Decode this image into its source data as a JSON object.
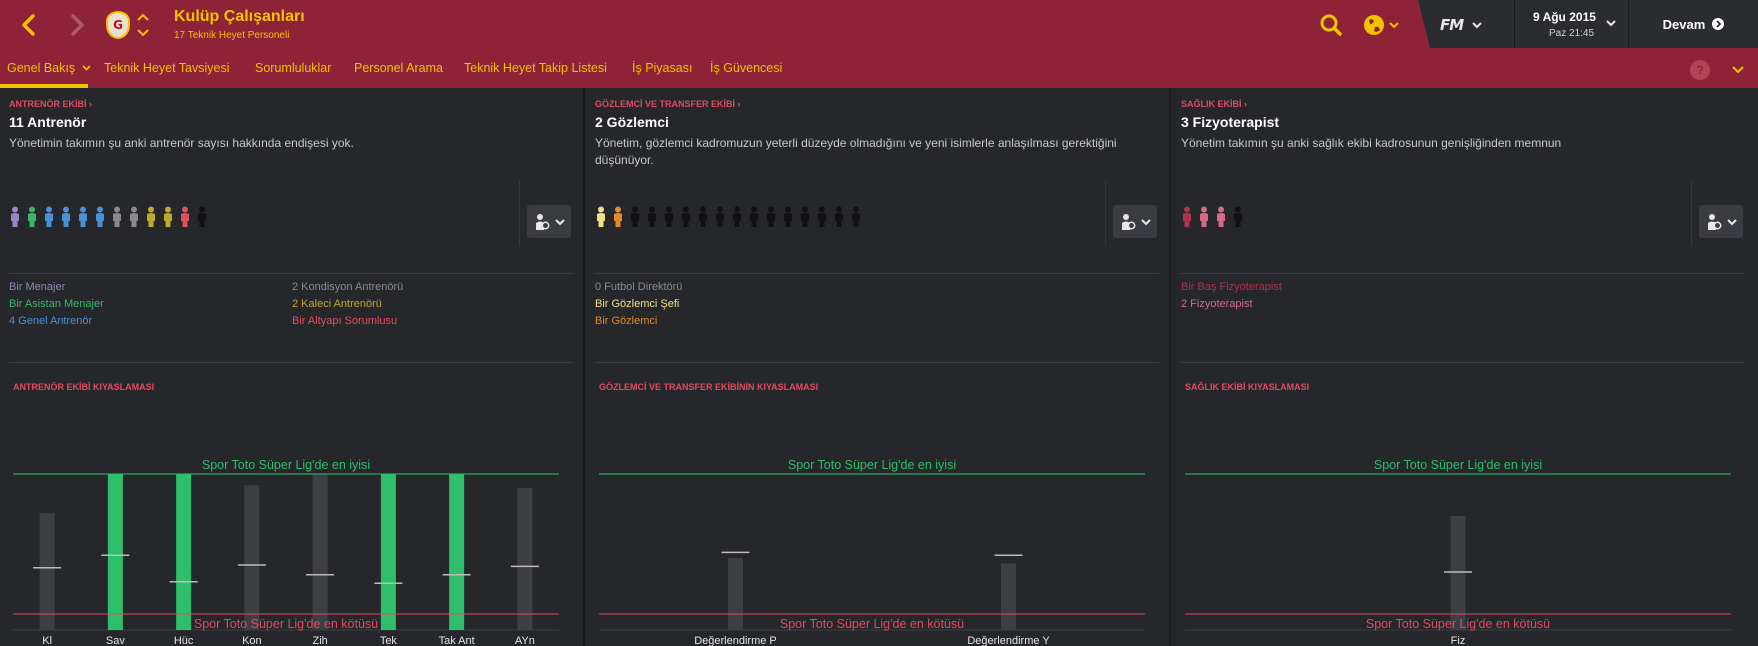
{
  "header": {
    "back_icon": "chevron-left-icon",
    "forward_icon": "chevron-right-icon",
    "club_badge_letter": "G",
    "title": "Kulüp Çalışanları",
    "subtitle": "17 Teknik Heyet Personeli",
    "game_logo": "FM",
    "date": "9 Ağu 2015",
    "time": "Paz 21:45",
    "continue_label": "Devam",
    "accent_color": "#f2c200",
    "bar_color": "#8e2337"
  },
  "tabs": [
    {
      "label": "Genel Bakış",
      "active": true
    },
    {
      "label": "Teknik Heyet Tavsiyesi"
    },
    {
      "label": "Sorumluluklar"
    },
    {
      "label": "Personel Arama"
    },
    {
      "label": "Teknik Heyet Takip Listesi"
    },
    {
      "label": "İş Piyasası"
    },
    {
      "label": "İş Güvencesi"
    }
  ],
  "help_label": "?",
  "panels": [
    {
      "section_label": "ANTRENÖR EKİBİ",
      "count_title": "11 Antrenör",
      "board_text": "Yönetimin takımın şu anki antrenör sayısı hakkında endişesi yok.",
      "people_colors": [
        "#9b86c4",
        "#3ab56c",
        "#4a90d6",
        "#4a90d6",
        "#4a90d6",
        "#4a90d6",
        "#8a8a8a",
        "#8a8a8a",
        "#c2a82c",
        "#c2a82c",
        "#e0505e",
        "#111111"
      ],
      "roles": [
        {
          "text": "Bir Menajer",
          "color": "#8f86b8"
        },
        {
          "text": "Bir Asistan Menajer",
          "color": "#3ab56c"
        },
        {
          "text": "4 Genel Antrenör",
          "color": "#4a90d6"
        },
        {
          "text": "2 Kondisyon Antrenörü",
          "color": "#8a8a8a"
        },
        {
          "text": "2 Kaleci Antrenörü",
          "color": "#c2a82c"
        },
        {
          "text": "Bir Altyapı Sorumlusu",
          "color": "#e0505e"
        }
      ],
      "comparison_label": "ANTRENÖR EKİBİ KIYASLAMASI",
      "best_label": "Spor Toto Süper Lig'de en iyisi",
      "worst_label": "Spor Toto Süper Lig'de en kötüsü"
    },
    {
      "section_label": "GÖZLEMCİ VE TRANSFER EKİBİ",
      "count_title": "2 Gözlemci",
      "board_text": "Yönetim, gözlemci kadromuzun yeterli düzeyde olmadığını ve yeni isimlerle anlaşılması gerektiğini düşünüyor.",
      "people_colors": [
        "#f0e08a",
        "#e08a2c",
        "#111111",
        "#111111",
        "#111111",
        "#111111",
        "#111111",
        "#111111",
        "#111111",
        "#111111",
        "#111111",
        "#111111",
        "#111111",
        "#111111",
        "#111111",
        "#111111"
      ],
      "roles": [
        {
          "text": "0 Futbol Direktörü",
          "color": "#8a8a8a"
        },
        {
          "text": "Bir Gözlemci Şefi",
          "color": "#f0e08a"
        },
        {
          "text": "Bir Gözlemci",
          "color": "#e08a2c"
        }
      ],
      "comparison_label": "GÖZLEMCİ VE TRANSFER EKİBİNİN KIYASLAMASI",
      "best_label": "Spor Toto Süper Lig'de en iyisi",
      "worst_label": "Spor Toto Süper Lig'de en kötüsü"
    },
    {
      "section_label": "SAĞLIK EKİBİ",
      "count_title": "3 Fizyoterapist",
      "board_text": "Yönetim takımın şu anki sağlık ekibi kadrosunun genişliğinden memnun",
      "people_colors": [
        "#b0314e",
        "#d46a8a",
        "#d46a8a",
        "#111111"
      ],
      "roles": [
        {
          "text": "Bir Baş Fizyoterapist",
          "color": "#b0314e"
        },
        {
          "text": "2 Fizyoterapist",
          "color": "#d46a8a"
        }
      ],
      "comparison_label": "SAĞLIK EKİBİ KIYASLAMASI",
      "best_label": "Spor Toto Süper Lig'de en iyisi",
      "worst_label": "Spor Toto Süper Lig'de en kötüsü"
    }
  ],
  "chart_data": [
    {
      "type": "bar",
      "categories": [
        "Kl",
        "Sav",
        "Hüc",
        "Kon",
        "Zih",
        "Tek",
        "Tak Ant",
        "AYn"
      ],
      "values": [
        0.72,
        1.0,
        1.0,
        0.92,
        1.0,
        1.0,
        1.0,
        0.9
      ],
      "at_best": [
        false,
        true,
        true,
        false,
        false,
        true,
        true,
        false
      ],
      "league_average": [
        0.33,
        0.42,
        0.23,
        0.35,
        0.28,
        0.22,
        0.28,
        0.34
      ],
      "ylim": [
        0,
        1
      ],
      "best_color": "#2fbf6a",
      "worst_color": "#e04b61"
    },
    {
      "type": "bar",
      "categories": [
        "Değerlendirme P",
        "Değerlendirme Y"
      ],
      "values": [
        0.4,
        0.36
      ],
      "at_best": [
        false,
        false
      ],
      "league_average": [
        0.44,
        0.42
      ],
      "ylim": [
        0,
        1
      ],
      "best_color": "#2fbf6a",
      "worst_color": "#e04b61"
    },
    {
      "type": "bar",
      "categories": [
        "Fiz"
      ],
      "values": [
        0.7
      ],
      "at_best": [
        false
      ],
      "league_average": [
        0.3
      ],
      "ylim": [
        0,
        1
      ],
      "best_color": "#2fbf6a",
      "worst_color": "#e04b61"
    }
  ]
}
